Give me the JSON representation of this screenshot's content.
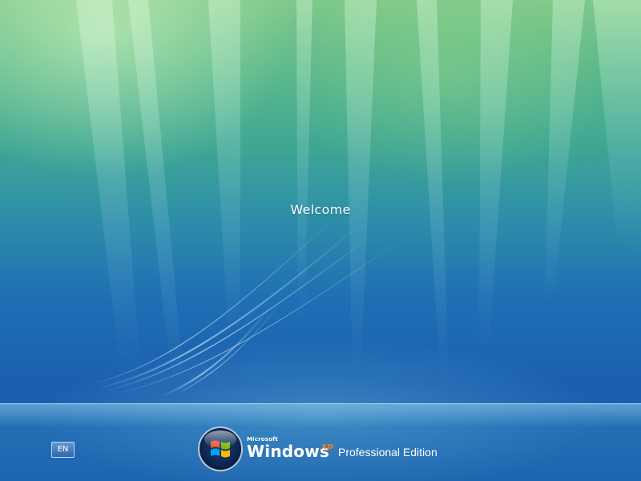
{
  "welcome_screen": {
    "message": "Welcome"
  },
  "language_bar": {
    "label": "EN"
  },
  "branding": {
    "company": "Microsoft",
    "product": "Windows",
    "version": "xp",
    "edition": "Professional Edition",
    "logo_icon": "windows-flag-orb"
  },
  "colors": {
    "background_top": "#7fc98a",
    "background_bottom": "#1d63ae",
    "text": "#ffffff",
    "xp_accent": "#ff7a1a"
  }
}
